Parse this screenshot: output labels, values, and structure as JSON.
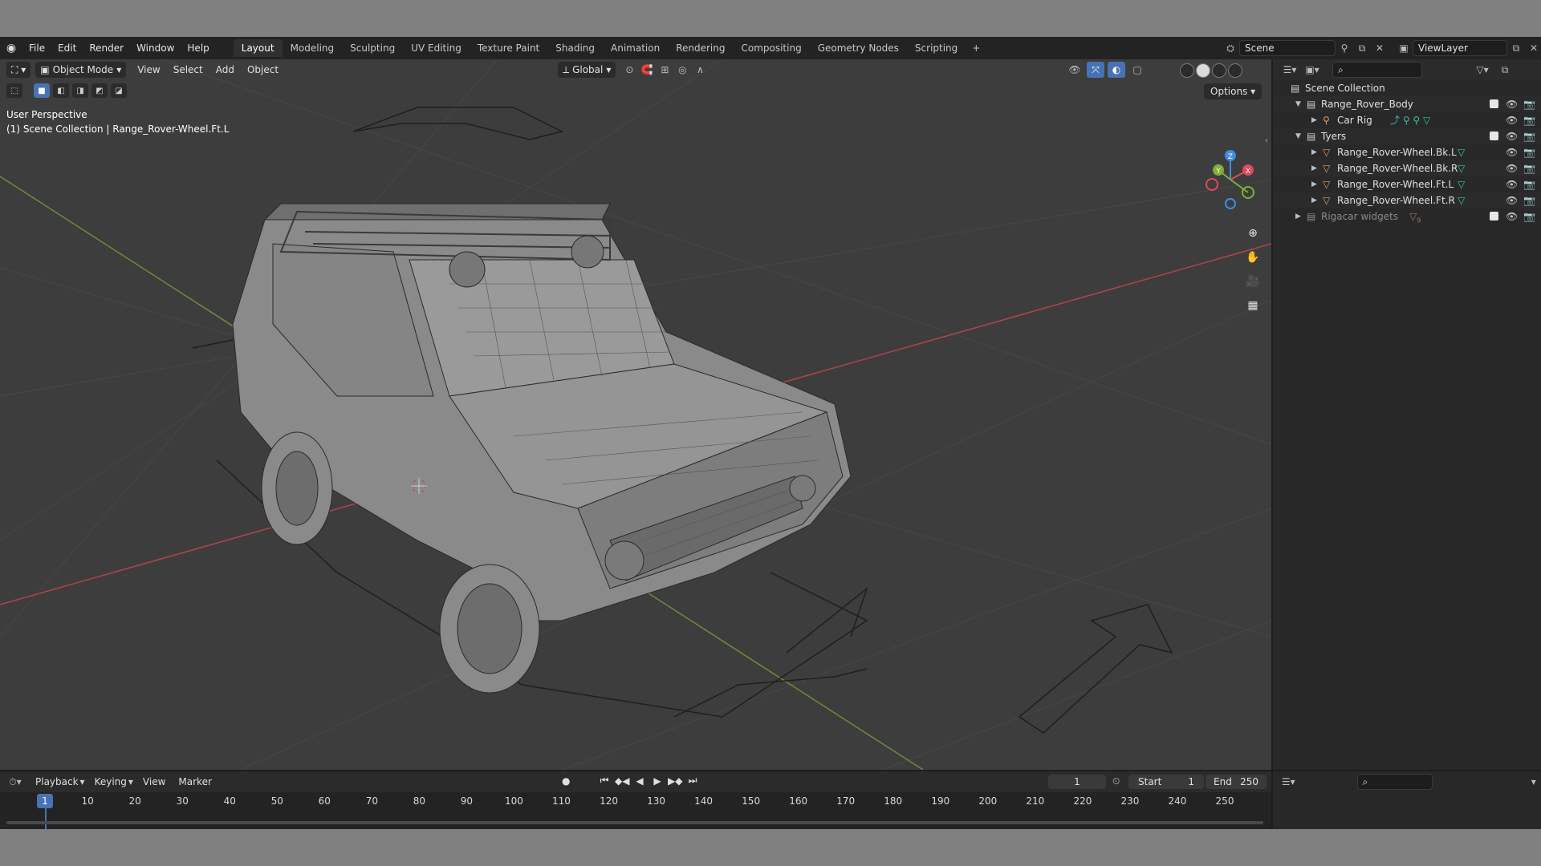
{
  "topbar": {
    "menus": [
      "File",
      "Edit",
      "Render",
      "Window",
      "Help"
    ],
    "workspaces": [
      "Layout",
      "Modeling",
      "Sculpting",
      "UV Editing",
      "Texture Paint",
      "Shading",
      "Animation",
      "Rendering",
      "Compositing",
      "Geometry Nodes",
      "Scripting"
    ],
    "active_workspace": "Layout",
    "scene": "Scene",
    "view_layer": "ViewLayer"
  },
  "viewport": {
    "mode": "Object Mode",
    "menus": [
      "View",
      "Select",
      "Add",
      "Object"
    ],
    "orientation": "Global",
    "options_label": "Options",
    "perspective": "User Perspective",
    "active_path": "(1) Scene Collection | Range_Rover-Wheel.Ft.L",
    "gizmo_axes": {
      "x": "X",
      "y": "Y",
      "z": "Z"
    }
  },
  "outliner": {
    "rows": [
      {
        "label": "Scene Collection",
        "indent": 0,
        "icon": "collection",
        "expand": "",
        "dim": false
      },
      {
        "label": "Range_Rover_Body",
        "indent": 1,
        "icon": "collection",
        "expand": "▼",
        "dim": false
      },
      {
        "label": "Car Rig",
        "indent": 2,
        "icon": "armature",
        "expand": "▶",
        "dim": false
      },
      {
        "label": "Tyers",
        "indent": 1,
        "icon": "collection",
        "expand": "▼",
        "dim": false
      },
      {
        "label": "Range_Rover-Wheel.Bk.L",
        "indent": 2,
        "icon": "mesh",
        "expand": "▶",
        "dim": false
      },
      {
        "label": "Range_Rover-Wheel.Bk.R",
        "indent": 2,
        "icon": "mesh",
        "expand": "▶",
        "dim": false
      },
      {
        "label": "Range_Rover-Wheel.Ft.L",
        "indent": 2,
        "icon": "mesh",
        "expand": "▶",
        "dim": false
      },
      {
        "label": "Range_Rover-Wheel.Ft.R",
        "indent": 2,
        "icon": "mesh",
        "expand": "▶",
        "dim": false
      },
      {
        "label": "Rigacar widgets",
        "indent": 1,
        "icon": "collection",
        "expand": "▶",
        "dim": true
      }
    ],
    "widget_count": "9",
    "rig_count": "5"
  },
  "timeline": {
    "menus": [
      "Playback",
      "Keying",
      "View",
      "Marker"
    ],
    "current_frame": "1",
    "start_label": "Start",
    "start": "1",
    "end_label": "End",
    "end": "250",
    "ticks": [
      "1",
      "10",
      "20",
      "30",
      "40",
      "50",
      "60",
      "70",
      "80",
      "90",
      "100",
      "110",
      "120",
      "130",
      "140",
      "150",
      "160",
      "170",
      "180",
      "190",
      "200",
      "210",
      "220",
      "230",
      "240",
      "250"
    ]
  },
  "colors": {
    "accent": "#4772b3",
    "x_axis": "#e04a5b",
    "y_axis": "#7fb036",
    "z_axis": "#3f8ce0",
    "mesh_icon": "#e89a5a",
    "data_icon": "#34c6a6"
  }
}
